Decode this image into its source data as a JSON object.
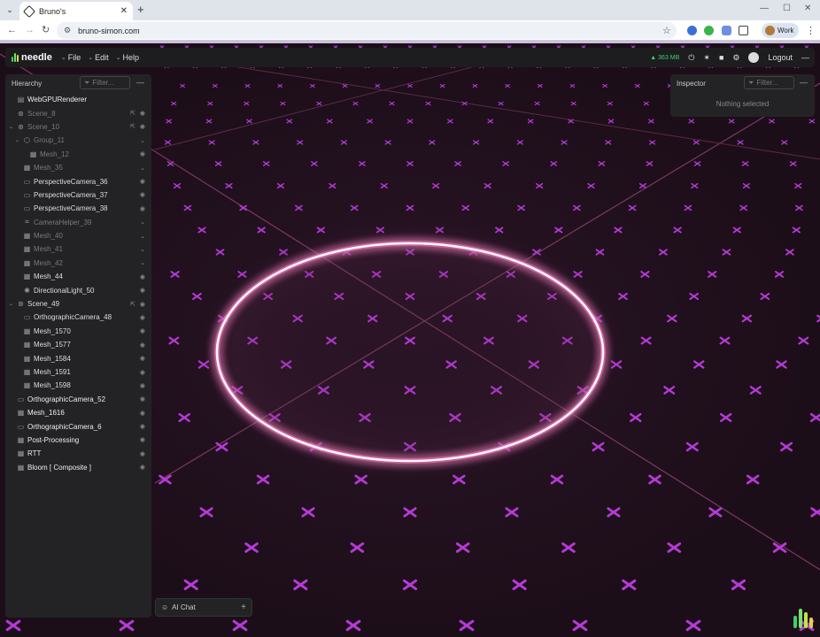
{
  "browser": {
    "tab_title": "Bruno's",
    "url": "bruno-simon.com",
    "profile_label": "Work"
  },
  "toolbar": {
    "brand": "needle",
    "menus": [
      "File",
      "Edit",
      "Help"
    ],
    "memory": "363 MB",
    "logout": "Logout"
  },
  "hierarchy": {
    "title": "Hierarchy",
    "filter_placeholder": "Filter...",
    "items": [
      {
        "label": "WebGPURenderer"
      },
      {
        "label": "Scene_8"
      },
      {
        "label": "Scene_10"
      },
      {
        "label": "Group_11"
      },
      {
        "label": "Mesh_12"
      },
      {
        "label": "Mesh_35"
      },
      {
        "label": "PerspectiveCamera_36"
      },
      {
        "label": "PerspectiveCamera_37"
      },
      {
        "label": "PerspectiveCamera_38"
      },
      {
        "label": "CameraHelper_39"
      },
      {
        "label": "Mesh_40"
      },
      {
        "label": "Mesh_41"
      },
      {
        "label": "Mesh_42"
      },
      {
        "label": "Mesh_44"
      },
      {
        "label": "DirectionalLight_50"
      },
      {
        "label": "Scene_49"
      },
      {
        "label": "OrthographicCamera_48"
      },
      {
        "label": "Mesh_1570"
      },
      {
        "label": "Mesh_1577"
      },
      {
        "label": "Mesh_1584"
      },
      {
        "label": "Mesh_1591"
      },
      {
        "label": "Mesh_1598"
      },
      {
        "label": "OrthographicCamera_52"
      },
      {
        "label": "Mesh_1616"
      },
      {
        "label": "OrthographicCamera_6"
      },
      {
        "label": "Post-Processing"
      },
      {
        "label": "RTT"
      },
      {
        "label": "Bloom [ Composite ]"
      }
    ]
  },
  "inspector": {
    "title": "Inspector",
    "filter_placeholder": "Filter...",
    "empty_text": "Nothing selected"
  },
  "ai_chat": {
    "label": "AI Chat"
  },
  "colors": {
    "marker": "#b53ad6",
    "ring": "#ffe6f2",
    "accent_green": "#3ecf6e"
  }
}
